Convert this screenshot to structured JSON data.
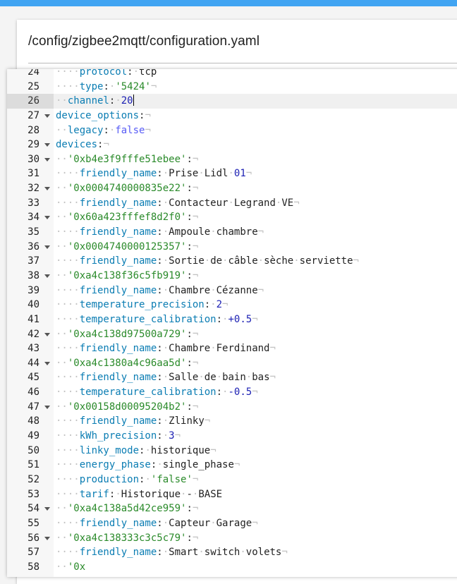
{
  "header": {
    "file_path": "/config/zigbee2mqtt/configuration.yaml"
  },
  "editor": {
    "active_line": 26,
    "lines": [
      {
        "num": 24,
        "fold": false,
        "segs": [
          [
            "ws",
            "····"
          ],
          [
            "k",
            "protocol"
          ],
          [
            "p",
            ":"
          ],
          [
            "ws",
            "·"
          ],
          [
            "t",
            "tcp"
          ]
        ]
      },
      {
        "num": 25,
        "fold": false,
        "segs": [
          [
            "ws",
            "····"
          ],
          [
            "k",
            "type"
          ],
          [
            "p",
            ":"
          ],
          [
            "ws",
            "·"
          ],
          [
            "s",
            "'5424'"
          ],
          [
            "ws",
            "¬"
          ]
        ]
      },
      {
        "num": 26,
        "fold": false,
        "cursor": true,
        "segs": [
          [
            "ws",
            "··"
          ],
          [
            "k",
            "channel"
          ],
          [
            "p",
            ":"
          ],
          [
            "ws",
            "·"
          ],
          [
            "n",
            "20"
          ]
        ]
      },
      {
        "num": 27,
        "fold": true,
        "segs": [
          [
            "k",
            "device_options"
          ],
          [
            "p",
            ":"
          ],
          [
            "ws",
            "¬"
          ]
        ]
      },
      {
        "num": 28,
        "fold": false,
        "segs": [
          [
            "ws",
            "··"
          ],
          [
            "k",
            "legacy"
          ],
          [
            "p",
            ":"
          ],
          [
            "ws",
            "·"
          ],
          [
            "b",
            "false"
          ],
          [
            "ws",
            "¬"
          ]
        ]
      },
      {
        "num": 29,
        "fold": true,
        "segs": [
          [
            "k",
            "devices"
          ],
          [
            "p",
            ":"
          ],
          [
            "ws",
            "¬"
          ]
        ]
      },
      {
        "num": 30,
        "fold": true,
        "segs": [
          [
            "ws",
            "··"
          ],
          [
            "s",
            "'0xb4e3f9fffe51ebee'"
          ],
          [
            "p",
            ":"
          ],
          [
            "ws",
            "¬"
          ]
        ]
      },
      {
        "num": 31,
        "fold": false,
        "segs": [
          [
            "ws",
            "····"
          ],
          [
            "k",
            "friendly_name"
          ],
          [
            "p",
            ":"
          ],
          [
            "ws",
            "·"
          ],
          [
            "t",
            "Prise"
          ],
          [
            "ws",
            "·"
          ],
          [
            "t",
            "Lidl"
          ],
          [
            "ws",
            "·"
          ],
          [
            "n",
            "01"
          ],
          [
            "ws",
            "¬"
          ]
        ]
      },
      {
        "num": 32,
        "fold": true,
        "segs": [
          [
            "ws",
            "··"
          ],
          [
            "s",
            "'0x0004740000835e22'"
          ],
          [
            "p",
            ":"
          ],
          [
            "ws",
            "¬"
          ]
        ]
      },
      {
        "num": 33,
        "fold": false,
        "segs": [
          [
            "ws",
            "····"
          ],
          [
            "k",
            "friendly_name"
          ],
          [
            "p",
            ":"
          ],
          [
            "ws",
            "·"
          ],
          [
            "t",
            "Contacteur"
          ],
          [
            "ws",
            "·"
          ],
          [
            "t",
            "Legrand"
          ],
          [
            "ws",
            "·"
          ],
          [
            "t",
            "VE"
          ],
          [
            "ws",
            "¬"
          ]
        ]
      },
      {
        "num": 34,
        "fold": true,
        "segs": [
          [
            "ws",
            "··"
          ],
          [
            "s",
            "'0x60a423fffef8d2f0'"
          ],
          [
            "p",
            ":"
          ],
          [
            "ws",
            "¬"
          ]
        ]
      },
      {
        "num": 35,
        "fold": false,
        "segs": [
          [
            "ws",
            "····"
          ],
          [
            "k",
            "friendly_name"
          ],
          [
            "p",
            ":"
          ],
          [
            "ws",
            "·"
          ],
          [
            "t",
            "Ampoule"
          ],
          [
            "ws",
            "·"
          ],
          [
            "t",
            "chambre"
          ],
          [
            "ws",
            "¬"
          ]
        ]
      },
      {
        "num": 36,
        "fold": true,
        "segs": [
          [
            "ws",
            "··"
          ],
          [
            "s",
            "'0x0004740000125357'"
          ],
          [
            "p",
            ":"
          ],
          [
            "ws",
            "¬"
          ]
        ]
      },
      {
        "num": 37,
        "fold": false,
        "segs": [
          [
            "ws",
            "····"
          ],
          [
            "k",
            "friendly_name"
          ],
          [
            "p",
            ":"
          ],
          [
            "ws",
            "·"
          ],
          [
            "t",
            "Sortie"
          ],
          [
            "ws",
            "·"
          ],
          [
            "t",
            "de"
          ],
          [
            "ws",
            "·"
          ],
          [
            "t",
            "câble"
          ],
          [
            "ws",
            "·"
          ],
          [
            "t",
            "sèche"
          ],
          [
            "ws",
            "·"
          ],
          [
            "t",
            "serviette"
          ],
          [
            "ws",
            "¬"
          ]
        ]
      },
      {
        "num": 38,
        "fold": true,
        "segs": [
          [
            "ws",
            "··"
          ],
          [
            "s",
            "'0xa4c138f36c5fb919'"
          ],
          [
            "p",
            ":"
          ],
          [
            "ws",
            "¬"
          ]
        ]
      },
      {
        "num": 39,
        "fold": false,
        "segs": [
          [
            "ws",
            "····"
          ],
          [
            "k",
            "friendly_name"
          ],
          [
            "p",
            ":"
          ],
          [
            "ws",
            "·"
          ],
          [
            "t",
            "Chambre"
          ],
          [
            "ws",
            "·"
          ],
          [
            "t",
            "Cézanne"
          ],
          [
            "ws",
            "¬"
          ]
        ]
      },
      {
        "num": 40,
        "fold": false,
        "segs": [
          [
            "ws",
            "····"
          ],
          [
            "k",
            "temperature_precision"
          ],
          [
            "p",
            ":"
          ],
          [
            "ws",
            "·"
          ],
          [
            "n",
            "2"
          ],
          [
            "ws",
            "¬"
          ]
        ]
      },
      {
        "num": 41,
        "fold": false,
        "segs": [
          [
            "ws",
            "····"
          ],
          [
            "k",
            "temperature_calibration"
          ],
          [
            "p",
            ":"
          ],
          [
            "ws",
            "·"
          ],
          [
            "n",
            "+0.5"
          ],
          [
            "ws",
            "¬"
          ]
        ]
      },
      {
        "num": 42,
        "fold": true,
        "segs": [
          [
            "ws",
            "··"
          ],
          [
            "s",
            "'0xa4c138d97500a729'"
          ],
          [
            "p",
            ":"
          ],
          [
            "ws",
            "¬"
          ]
        ]
      },
      {
        "num": 43,
        "fold": false,
        "segs": [
          [
            "ws",
            "····"
          ],
          [
            "k",
            "friendly_name"
          ],
          [
            "p",
            ":"
          ],
          [
            "ws",
            "·"
          ],
          [
            "t",
            "Chambre"
          ],
          [
            "ws",
            "·"
          ],
          [
            "t",
            "Ferdinand"
          ],
          [
            "ws",
            "¬"
          ]
        ]
      },
      {
        "num": 44,
        "fold": true,
        "segs": [
          [
            "ws",
            "··"
          ],
          [
            "s",
            "'0xa4c1380a4c96aa5d'"
          ],
          [
            "p",
            ":"
          ],
          [
            "ws",
            "¬"
          ]
        ]
      },
      {
        "num": 45,
        "fold": false,
        "segs": [
          [
            "ws",
            "····"
          ],
          [
            "k",
            "friendly_name"
          ],
          [
            "p",
            ":"
          ],
          [
            "ws",
            "·"
          ],
          [
            "t",
            "Salle"
          ],
          [
            "ws",
            "·"
          ],
          [
            "t",
            "de"
          ],
          [
            "ws",
            "·"
          ],
          [
            "t",
            "bain"
          ],
          [
            "ws",
            "·"
          ],
          [
            "t",
            "bas"
          ],
          [
            "ws",
            "¬"
          ]
        ]
      },
      {
        "num": 46,
        "fold": false,
        "segs": [
          [
            "ws",
            "····"
          ],
          [
            "k",
            "temperature_calibration"
          ],
          [
            "p",
            ":"
          ],
          [
            "ws",
            "·"
          ],
          [
            "n",
            "-0.5"
          ],
          [
            "ws",
            "¬"
          ]
        ]
      },
      {
        "num": 47,
        "fold": true,
        "segs": [
          [
            "ws",
            "··"
          ],
          [
            "s",
            "'0x00158d00095204b2'"
          ],
          [
            "p",
            ":"
          ],
          [
            "ws",
            "¬"
          ]
        ]
      },
      {
        "num": 48,
        "fold": false,
        "segs": [
          [
            "ws",
            "····"
          ],
          [
            "k",
            "friendly_name"
          ],
          [
            "p",
            ":"
          ],
          [
            "ws",
            "·"
          ],
          [
            "t",
            "Zlinky"
          ],
          [
            "ws",
            "¬"
          ]
        ]
      },
      {
        "num": 49,
        "fold": false,
        "segs": [
          [
            "ws",
            "····"
          ],
          [
            "k",
            "kWh_precision"
          ],
          [
            "p",
            ":"
          ],
          [
            "ws",
            "·"
          ],
          [
            "n",
            "3"
          ],
          [
            "ws",
            "¬"
          ]
        ]
      },
      {
        "num": 50,
        "fold": false,
        "segs": [
          [
            "ws",
            "····"
          ],
          [
            "k",
            "linky_mode"
          ],
          [
            "p",
            ":"
          ],
          [
            "ws",
            "·"
          ],
          [
            "t",
            "historique"
          ],
          [
            "ws",
            "¬"
          ]
        ]
      },
      {
        "num": 51,
        "fold": false,
        "segs": [
          [
            "ws",
            "····"
          ],
          [
            "k",
            "energy_phase"
          ],
          [
            "p",
            ":"
          ],
          [
            "ws",
            "·"
          ],
          [
            "t",
            "single_phase"
          ],
          [
            "ws",
            "¬"
          ]
        ]
      },
      {
        "num": 52,
        "fold": false,
        "segs": [
          [
            "ws",
            "····"
          ],
          [
            "k",
            "production"
          ],
          [
            "p",
            ":"
          ],
          [
            "ws",
            "·"
          ],
          [
            "s",
            "'false'"
          ],
          [
            "ws",
            "¬"
          ]
        ]
      },
      {
        "num": 53,
        "fold": false,
        "segs": [
          [
            "ws",
            "····"
          ],
          [
            "k",
            "tarif"
          ],
          [
            "p",
            ":"
          ],
          [
            "ws",
            "·"
          ],
          [
            "t",
            "Historique"
          ],
          [
            "ws",
            "·"
          ],
          [
            "t",
            "-"
          ],
          [
            "ws",
            "·"
          ],
          [
            "t",
            "BASE"
          ]
        ]
      },
      {
        "num": 54,
        "fold": true,
        "segs": [
          [
            "ws",
            "··"
          ],
          [
            "s",
            "'0xa4c138a5d42ce959'"
          ],
          [
            "p",
            ":"
          ],
          [
            "ws",
            "¬"
          ]
        ]
      },
      {
        "num": 55,
        "fold": false,
        "segs": [
          [
            "ws",
            "····"
          ],
          [
            "k",
            "friendly_name"
          ],
          [
            "p",
            ":"
          ],
          [
            "ws",
            "·"
          ],
          [
            "t",
            "Capteur"
          ],
          [
            "ws",
            "·"
          ],
          [
            "t",
            "Garage"
          ],
          [
            "ws",
            "¬"
          ]
        ]
      },
      {
        "num": 56,
        "fold": true,
        "segs": [
          [
            "ws",
            "··"
          ],
          [
            "s",
            "'0xa4c138333c3c5c79'"
          ],
          [
            "p",
            ":"
          ],
          [
            "ws",
            "¬"
          ]
        ]
      },
      {
        "num": 57,
        "fold": false,
        "segs": [
          [
            "ws",
            "····"
          ],
          [
            "k",
            "friendly_name"
          ],
          [
            "p",
            ":"
          ],
          [
            "ws",
            "·"
          ],
          [
            "t",
            "Smart"
          ],
          [
            "ws",
            "·"
          ],
          [
            "t",
            "switch"
          ],
          [
            "ws",
            "·"
          ],
          [
            "t",
            "volets"
          ],
          [
            "ws",
            "¬"
          ]
        ]
      },
      {
        "num": 58,
        "fold": false,
        "segs": [
          [
            "ws",
            "··"
          ],
          [
            "s",
            "'0x"
          ]
        ]
      }
    ]
  }
}
